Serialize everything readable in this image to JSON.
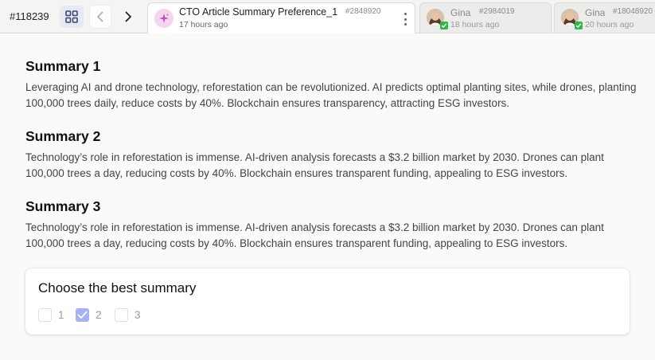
{
  "topbar": {
    "task_id": "#118239",
    "tabs": [
      {
        "title": "CTO Article Summary Preference_1",
        "number": "#2848920",
        "time": "17 hours ago"
      },
      {
        "name": "Gina",
        "number": "#2984019",
        "time": "18 hours ago"
      },
      {
        "name": "Gina",
        "number": "#18048920",
        "time": "20 hours ago"
      }
    ]
  },
  "summaries": [
    {
      "title": "Summary 1",
      "text": "Leveraging AI and drone technology, reforestation can be revolutionized. AI predicts optimal planting sites, while drones, planting 100,000 trees daily, reduce costs by 40%. Blockchain ensures transparency, attracting ESG investors."
    },
    {
      "title": "Summary 2",
      "text": "Technology’s role in reforestation is immense. AI-driven analysis forecasts a $3.2 billion market by 2030. Drones can plant 100,000 trees a day, reducing costs by 40%. Blockchain ensures transparent funding, appealing to ESG investors."
    },
    {
      "title": "Summary 3",
      "text": "Technology’s role in reforestation is immense. AI-driven analysis forecasts a $3.2 billion market by 2030. Drones can plant 100,000 trees a day, reducing costs by 40%. Blockchain ensures transparent funding, appealing to ESG investors."
    }
  ],
  "choice": {
    "title": "Choose the best summary",
    "options": [
      {
        "label": "1",
        "checked": false
      },
      {
        "label": "2",
        "checked": true
      },
      {
        "label": "3",
        "checked": false
      }
    ]
  },
  "colors": {
    "accent": "#a7b2f5",
    "active_badge": "#2fb84a",
    "tab_icon_bg": "#f3d6ee"
  },
  "icons": [
    "grid-icon",
    "chevron-left-icon",
    "chevron-right-icon",
    "sparkle-icon",
    "more-vertical-icon",
    "avatar",
    "check-icon"
  ]
}
